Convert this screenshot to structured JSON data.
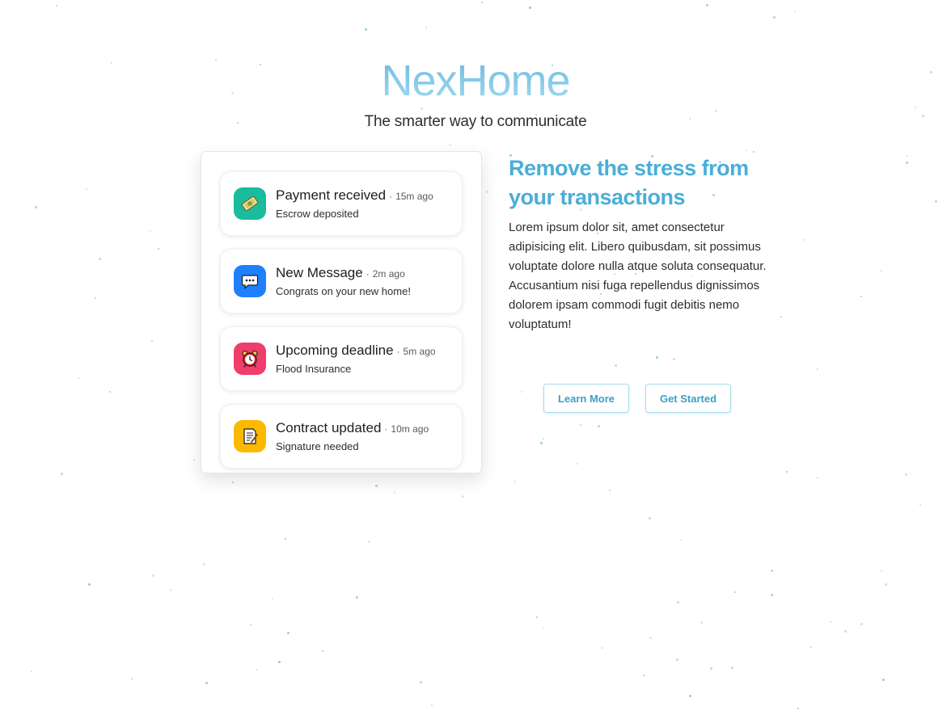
{
  "brand": {
    "title": "NexHome",
    "subtitle": "The smarter way to communicate"
  },
  "notifications": [
    {
      "title": "Payment received",
      "time": "15m ago",
      "desc": "Escrow deposited",
      "icon": "money-icon",
      "color": "#1abc9c"
    },
    {
      "title": "New Message",
      "time": "2m ago",
      "desc": "Congrats on your new home!",
      "icon": "chat-bubble-icon",
      "color": "#1f80ff"
    },
    {
      "title": "Upcoming deadline",
      "time": "5m ago",
      "desc": "Flood Insurance",
      "icon": "alarm-clock-icon",
      "color": "#f03e6a"
    },
    {
      "title": "Contract updated",
      "time": "10m ago",
      "desc": "Signature needed",
      "icon": "document-icon",
      "color": "#fcb900"
    }
  ],
  "separator": "·",
  "hero": {
    "heading": "Remove the stress from your transactions",
    "body": "Lorem ipsum dolor sit, amet consectetur adipisicing elit. Libero quibusdam, sit possimus voluptate dolore nulla atque soluta consequatur. Accusantium nisi fuga repellendus dignissimos dolorem ipsam commodi fugit debitis nemo voluptatum!"
  },
  "buttons": {
    "learn_more": "Learn More",
    "get_started": "Get Started"
  },
  "colors": {
    "accent": "#4aaed7",
    "brand_gradient_top": "#64b8df",
    "brand_gradient_bottom": "#a9dcf1",
    "button_border": "#a8dbef",
    "particle": "#7cc4e3"
  }
}
